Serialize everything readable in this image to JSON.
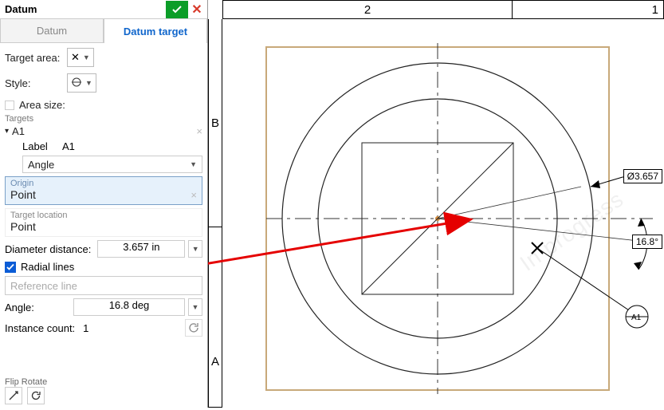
{
  "panel": {
    "title": "Datum",
    "tabs": {
      "datum": "Datum",
      "datum_target": "Datum target"
    },
    "target_area_label": "Target area:",
    "style_label": "Style:",
    "area_size_label": "Area size:",
    "targets_section": "Targets",
    "a1": {
      "name": "A1",
      "label_caption": "Label",
      "label_value": "A1",
      "angle_caption": "Angle",
      "origin_caption": "Origin",
      "origin_value": "Point",
      "target_location_caption": "Target location",
      "target_location_value": "Point",
      "diameter_label": "Diameter distance:",
      "diameter_value": "3.657 in",
      "radial_lines_label": "Radial lines",
      "radial_lines_checked": true,
      "reference_line_placeholder": "Reference line",
      "angle_label": "Angle:",
      "angle_value": "16.8 deg",
      "instance_count_label": "Instance count:",
      "instance_count_value": "1"
    },
    "flip_rotate_caption": "Flip  Rotate"
  },
  "ruler": {
    "col2": "2",
    "col1": "1",
    "rowB": "B",
    "rowA": "A"
  },
  "drawing": {
    "diameter_label": "Ø3.657",
    "angle_label": "16.8°",
    "datum_target": "A1",
    "datum_flag": "A1",
    "watermark": "In progress"
  }
}
